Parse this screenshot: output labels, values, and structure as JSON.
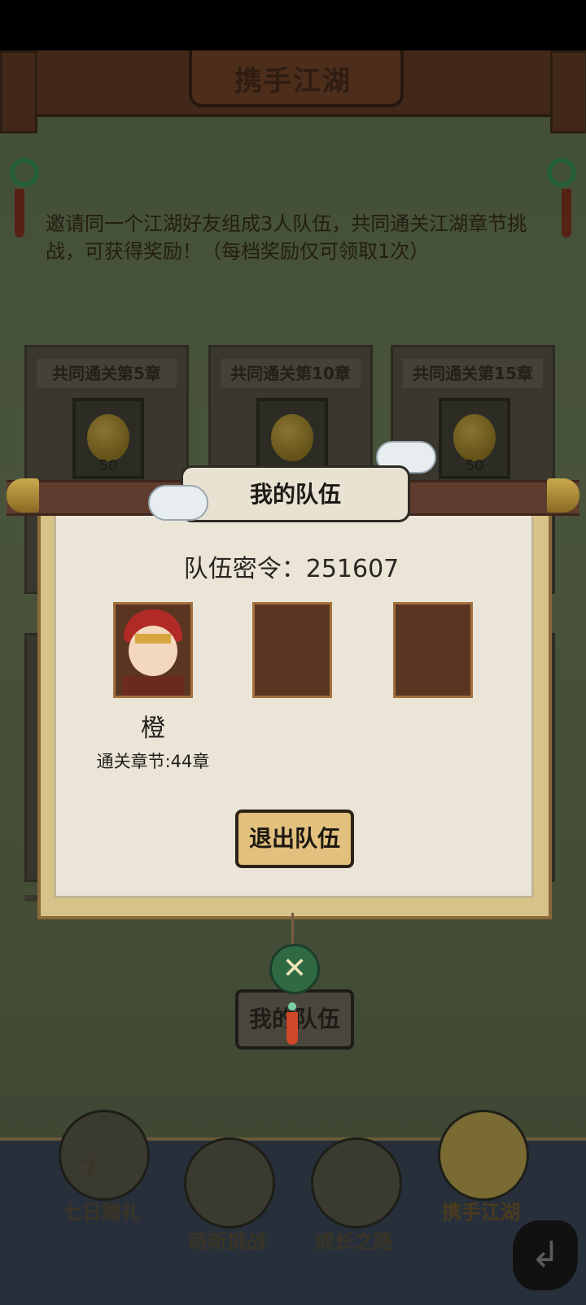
{
  "header": {
    "title": "携手江湖"
  },
  "intro_text": "邀请同一个江湖好友组成3人队伍，共同通关江湖章节挑战，可获得奖励！（每档奖励仅可领取1次）",
  "rewards": [
    {
      "label": "共同通关第5章",
      "quantity": "50",
      "icon": "golden-seed-icon"
    },
    {
      "label": "共同通关第10章",
      "quantity": "",
      "icon": "golden-seed-icon"
    },
    {
      "label": "共同通关第15章",
      "quantity": "50",
      "icon": "golden-seed-icon"
    }
  ],
  "modal": {
    "title": "我的队伍",
    "team_code_label": "队伍密令：251607",
    "members": [
      {
        "name": "橙",
        "chapter": "通关章节:44章"
      }
    ],
    "exit_button": "退出队伍",
    "close_icon": "close-icon"
  },
  "my_team_button": "我的队伍",
  "bottom_nav": [
    {
      "label": "七日赠礼",
      "badge": "7"
    },
    {
      "label": "萌新挑战"
    },
    {
      "label": "成长之路"
    },
    {
      "label": "携手江湖"
    }
  ],
  "colors": {
    "accent": "#e2c07e",
    "modal_bg": "#ebe5d8",
    "header": "#5a3422"
  }
}
